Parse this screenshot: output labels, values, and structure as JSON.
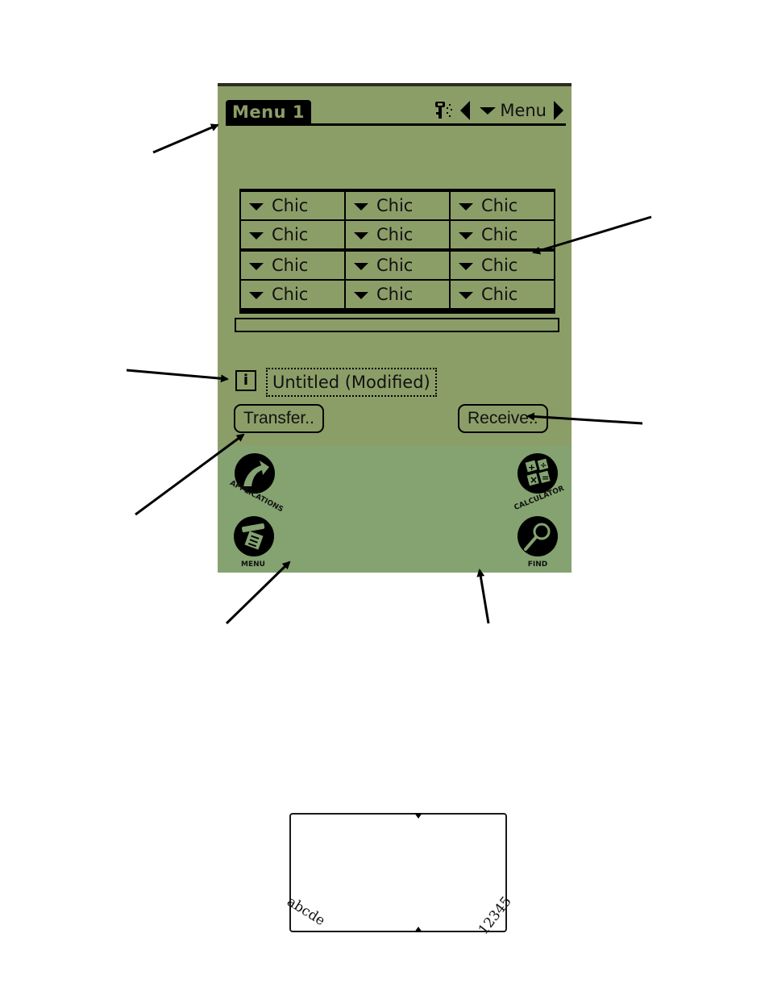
{
  "header": {
    "form_title": "Menu 1",
    "beam_icon": "ir-beam-icon",
    "prev_icon": "left-arrow-icon",
    "selector_label": "Menu",
    "next_icon": "right-arrow-icon"
  },
  "table": {
    "rows": [
      [
        "Chic",
        "Chic",
        "Chic"
      ],
      [
        "Chic",
        "Chic",
        "Chic"
      ],
      [
        "Chic",
        "Chic",
        "Chic"
      ],
      [
        "Chic",
        "Chic",
        "Chic"
      ]
    ]
  },
  "document": {
    "info_icon": "i",
    "name": "Untitled (Modified)"
  },
  "buttons": {
    "transfer": "Transfer..",
    "receive": "Receive.."
  },
  "silkscreen": {
    "applications": "APPLICATIONS",
    "menu": "MENU",
    "calculator": "CALCULATOR",
    "find": "FIND",
    "graffiti_alpha": "abcde",
    "graffiti_numeric": "12345"
  },
  "colors": {
    "screen": "#8c9e68",
    "silkscreen": "#84a370",
    "ink": "#000000"
  }
}
